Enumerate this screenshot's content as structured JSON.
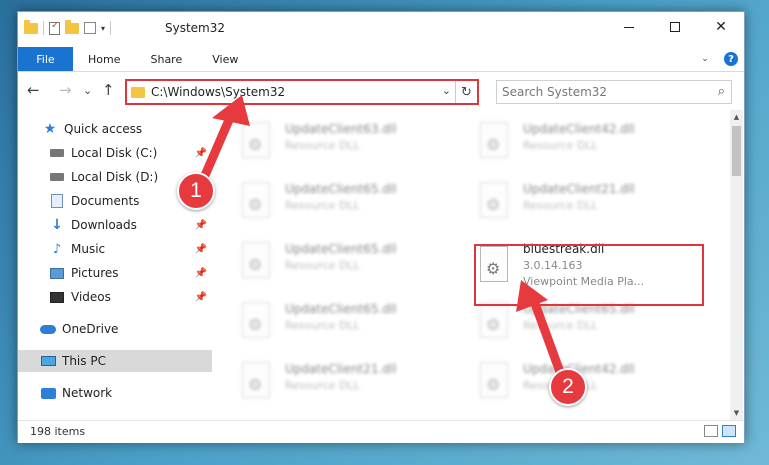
{
  "window": {
    "title": "System32",
    "qat_caret": "▾"
  },
  "controls": {
    "minimize": "",
    "maximize": "",
    "close": "✕"
  },
  "ribbon": {
    "tabs": [
      "File",
      "Home",
      "Share",
      "View"
    ],
    "expand": "⌄",
    "help": "?"
  },
  "nav": {
    "back": "←",
    "forward": "→",
    "recent": "⌄",
    "up": "↑"
  },
  "address": {
    "path": "C:\\Windows\\System32",
    "caret": "⌄",
    "refresh": "↻"
  },
  "search": {
    "placeholder": "Search System32",
    "icon": "⌕"
  },
  "sidebar": {
    "items": [
      {
        "label": "Quick access"
      },
      {
        "label": "Local Disk (C:)"
      },
      {
        "label": "Local Disk (D:)"
      },
      {
        "label": "Documents"
      },
      {
        "label": "Downloads"
      },
      {
        "label": "Music"
      },
      {
        "label": "Pictures"
      },
      {
        "label": "Videos"
      },
      {
        "label": "OneDrive"
      },
      {
        "label": "This PC"
      },
      {
        "label": "Network"
      }
    ],
    "pin_glyph": "📌"
  },
  "files": {
    "left_column": [
      {
        "name": "UpdateClient63.dll",
        "type": "Resource DLL"
      },
      {
        "name": "UpdateClient65.dll",
        "type": "Resource DLL"
      },
      {
        "name": "UpdateClient65.dll",
        "type": "Resource DLL"
      },
      {
        "name": "UpdateClient65.dll",
        "type": "Resource DLL"
      },
      {
        "name": "UpdateClient21.dll",
        "type": "Resource DLL"
      }
    ],
    "right_column": [
      {
        "name": "UpdateClient42.dll",
        "type": "Resource DLL"
      },
      {
        "name": "UpdateClient21.dll",
        "type": "Resource DLL"
      },
      {
        "name": "bluestreak.dll",
        "version": "3.0.14.163",
        "type": "Viewpoint Media Pla..."
      },
      {
        "name": "UpdateClient65.dll",
        "type": "Resource DLL"
      },
      {
        "name": "UpdateClient42.dll",
        "type": "Resource DLL"
      }
    ],
    "gear_glyph": "⚙"
  },
  "scroll": {
    "up": "▲",
    "down": "▼"
  },
  "status": {
    "count": "198 items"
  },
  "annotations": {
    "marker1": "1",
    "marker2": "2",
    "color": "#e63a3f"
  }
}
